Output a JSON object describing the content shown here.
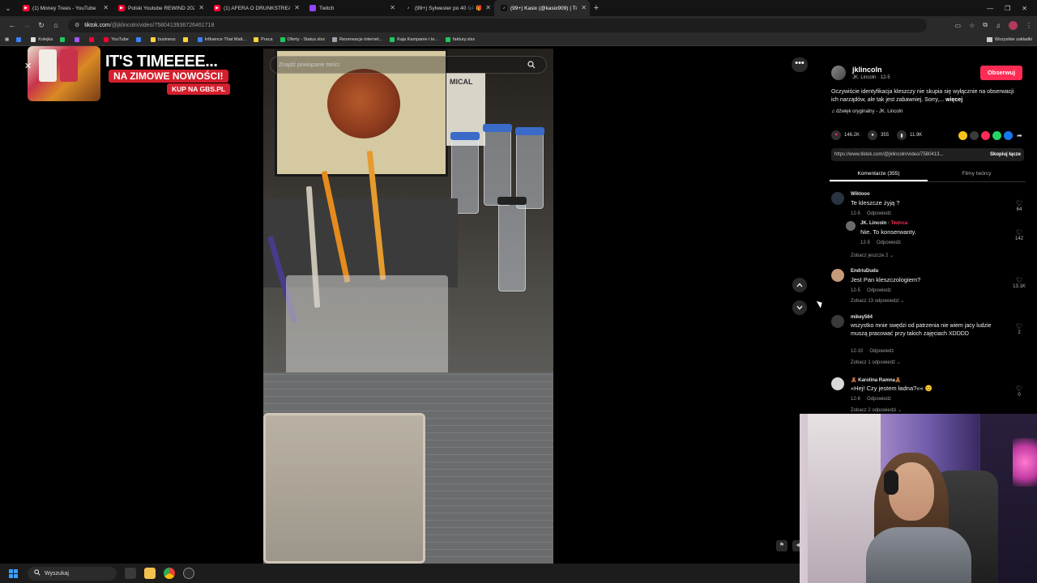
{
  "browser": {
    "tabs": [
      {
        "title": "(1) Money Trees - YouTube",
        "favicon_color": "#ff0033",
        "active": false
      },
      {
        "title": "Polski Youtube REWIND 2025 |",
        "favicon_color": "#ff0033",
        "active": false
      },
      {
        "title": "(1) AFERA O DRUNKSTREAM II",
        "favicon_color": "#ff0033",
        "active": false
      },
      {
        "title": "Twitch",
        "favicon_color": "#9146ff",
        "active": false
      },
      {
        "title": "(99+) Sylwester po 40 🎶 🎁 #",
        "favicon_color": "#ffffff",
        "active": false
      },
      {
        "title": "(99+) Kasix (@kasix909) | Ti",
        "favicon_color": "#ffffff",
        "active": true
      }
    ],
    "new_tab": "+",
    "address": {
      "host": "tiktok.com",
      "path": "/@jklincoln/video/7580413936726461718"
    },
    "bookmarks": [
      {
        "label": "",
        "color": "#3b82f6"
      },
      {
        "label": "Kolejka",
        "color": "#e0e0e0"
      },
      {
        "label": "",
        "color": "#22c55e"
      },
      {
        "label": "",
        "color": "#a855f7"
      },
      {
        "label": "",
        "color": "#ff0033"
      },
      {
        "label": "YouTube",
        "color": "#ff0033"
      },
      {
        "label": "",
        "color": "#3b82f6"
      },
      {
        "label": "business",
        "color": "#ffd43b"
      },
      {
        "label": "",
        "color": "#ffd43b"
      },
      {
        "label": "Influence That Matt...",
        "color": "#3b82f6"
      },
      {
        "label": "Praca",
        "color": "#ffd43b"
      },
      {
        "label": "Oferty - Status.xlsx",
        "color": "#22c55e"
      },
      {
        "label": "Rezerwacje internet...",
        "color": "#9ca3af"
      },
      {
        "label": "Kaja Kampanie i te...",
        "color": "#22c55e"
      },
      {
        "label": "faktury.xlsx",
        "color": "#22c55e"
      }
    ],
    "all_bookmarks": "Wszystkie zakładki"
  },
  "ad": {
    "headline": "IT'S TIMEEEE...",
    "sub": "NA ZIMOWE NOWOŚCI!",
    "cta": "KUP NA GBS.PL",
    "close": "✕"
  },
  "video": {
    "search_placeholder": "Znajdź powiązane treści",
    "box_label": "MICAL"
  },
  "post": {
    "author": "jklincoln",
    "author_sub": "JK. Lincoln · 12-5",
    "follow": "Obserwuj",
    "description": "Oczywiście identyfikacja kleszczy nie skupia się wyłącznie na obserwacji ich narządów, ale tak jest zabawniej. Sorry,...",
    "description_more": "więcej",
    "music": "♫ dźwięk oryginalny - JK. Lincoln",
    "likes": "146.2K",
    "comments": "355",
    "saves": "11.9K",
    "link": "https://www.tiktok.com/@jklincoln/video/7580413...",
    "copy": "Skopiuj łącze",
    "tab_comments": "Komentarze (355)",
    "tab_creator": "Filmy twórcy"
  },
  "comments": [
    {
      "user": "Wiktooo",
      "text": "Te kleszcze żyją ?",
      "date": "12-5",
      "reply": "Odpowiedz",
      "likes": "64",
      "avatar": "#2a3340",
      "more": ""
    },
    {
      "user": "JK. Lincoln · ",
      "creator": "Twórca",
      "text": "Nie. To konserwanty.",
      "date": "12-5",
      "reply": "Odpowiedz",
      "likes": "142",
      "avatar": "#6b6b6b",
      "more": "Zobacz jeszcze 2 ⌄"
    },
    {
      "user": "EndriuDudu",
      "text": "Jest Pan kleszczologiem?",
      "date": "12-5",
      "reply": "Odpowiedz",
      "likes": "13.1K",
      "avatar": "#c79a7a",
      "more": "Zobacz 13 odpowiedzi ⌄"
    },
    {
      "user": "mikey564",
      "text": "wszystko mnie swędzi od patrzenia nie wiem jacy ludzie muszą pracować przy takich zajęciach XDDDD",
      "date": "12-10",
      "reply": "Odpowiedz",
      "likes": "2",
      "avatar": "#3a3a3a",
      "more": "Zobacz 1 odpowiedź ⌄"
    },
    {
      "user": "🧸 Karolina Ramna🧸",
      "text": "«Hej! Czy jestem ładna?«« 😊",
      "date": "12-6",
      "reply": "Odpowiedz",
      "likes": "0",
      "avatar": "#d8d8d8",
      "more": "Zobacz 2 odpowiedzi ⌄"
    }
  ],
  "taskbar": {
    "search": "Wyszukaj"
  },
  "colors": {
    "accent": "#fe2c55",
    "panel_bg": "#000000",
    "tab_strip": "#141414",
    "toolbar": "#2a2a2a"
  },
  "icons": [
    "chevron-down-icon",
    "close-icon",
    "back-icon",
    "forward-icon",
    "reload-icon",
    "home-icon",
    "star-icon",
    "extensions-icon",
    "search-icon",
    "more-icon",
    "arrow-up-icon",
    "arrow-down-icon",
    "heart-icon",
    "comment-icon",
    "bookmark-icon",
    "share-icon",
    "music-icon",
    "windows-start-icon"
  ]
}
